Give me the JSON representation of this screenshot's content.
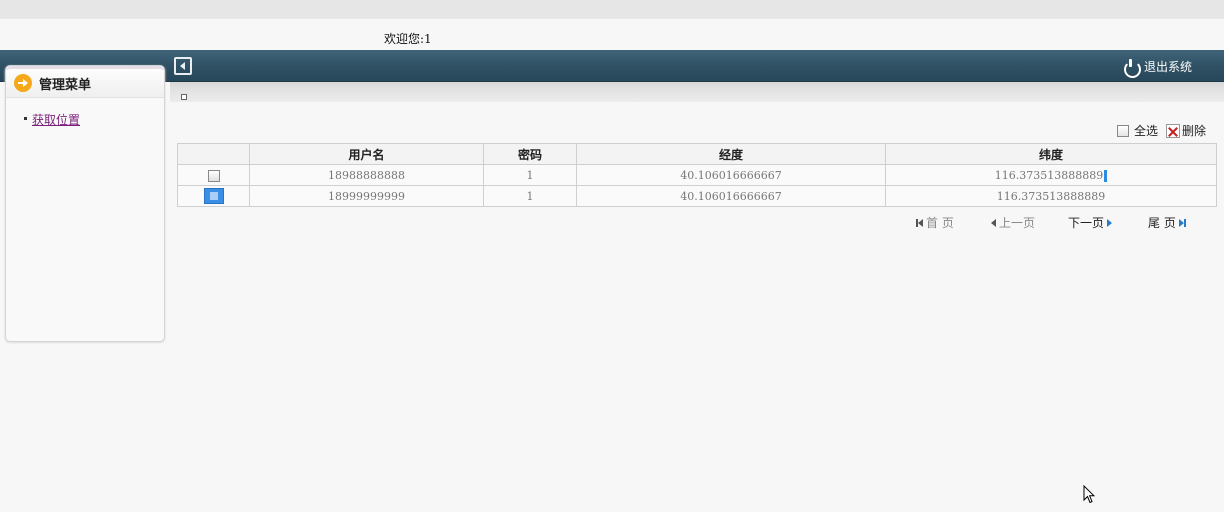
{
  "header": {
    "welcome": "欢迎您:1",
    "logout_label": "退出系统"
  },
  "sidebar": {
    "title": "管理菜单",
    "items": [
      {
        "label": "获取位置"
      }
    ]
  },
  "toolbar": {
    "select_all_label": "全选",
    "delete_label": "删除"
  },
  "table": {
    "columns": [
      "",
      "用户名",
      "密码",
      "经度",
      "纬度"
    ],
    "rows": [
      {
        "selected": false,
        "username": "18988888888",
        "password": "1",
        "longitude": "40.106016666667",
        "latitude": "116.373513888889"
      },
      {
        "selected": true,
        "username": "18999999999",
        "password": "1",
        "longitude": "40.106016666667",
        "latitude": "116.373513888889"
      }
    ]
  },
  "pager": {
    "first": "首 页",
    "prev": "上一页",
    "next": "下一页",
    "last": "尾 页"
  },
  "colors": {
    "header_bg": "#2f5063",
    "accent_orange": "#f4a81a",
    "selected_blue": "#3a8ee6",
    "link_purple": "#7a1f7a"
  }
}
